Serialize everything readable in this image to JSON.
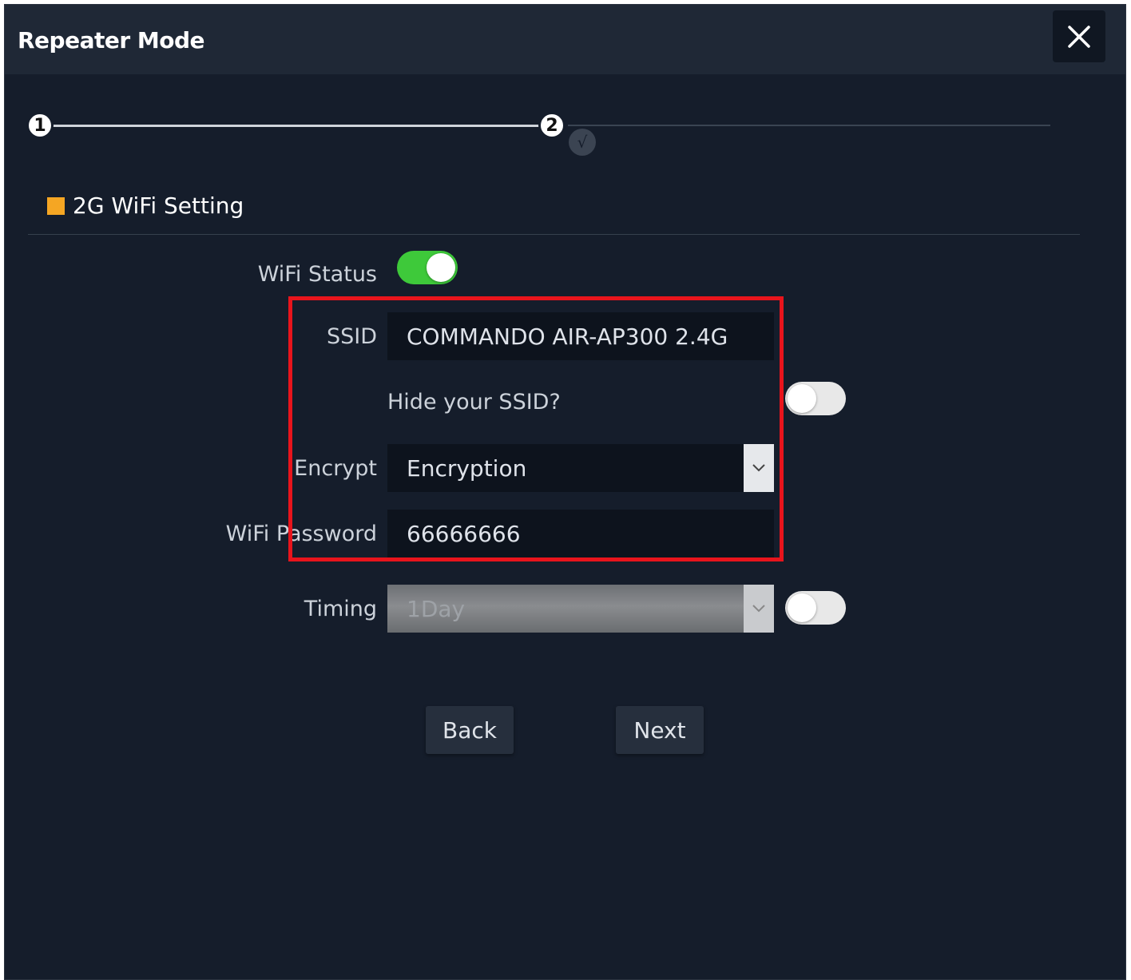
{
  "dialog": {
    "title": "Repeater Mode"
  },
  "stepper": {
    "step1": "1",
    "step2": "2",
    "step3": "√"
  },
  "section": {
    "title": "2G WiFi Setting",
    "marker_color": "#f5a623"
  },
  "form": {
    "wifi_status_label": "WiFi Status",
    "wifi_status_on": true,
    "ssid_label": "SSID",
    "ssid_value": "COMMANDO AIR-AP300 2.4G",
    "hide_ssid_label": "Hide your SSID?",
    "hide_ssid_on": false,
    "encrypt_label": "Encrypt",
    "encrypt_value": "Encryption",
    "password_label": "WiFi Password",
    "password_value": "66666666",
    "timing_label": "Timing",
    "timing_value": "1Day",
    "timing_on": false
  },
  "buttons": {
    "back": "Back",
    "next": "Next"
  },
  "colors": {
    "background": "#151d2b",
    "title_bar": "#1f2836",
    "toggle_on": "#3ec93a",
    "highlight": "#e8141c"
  }
}
